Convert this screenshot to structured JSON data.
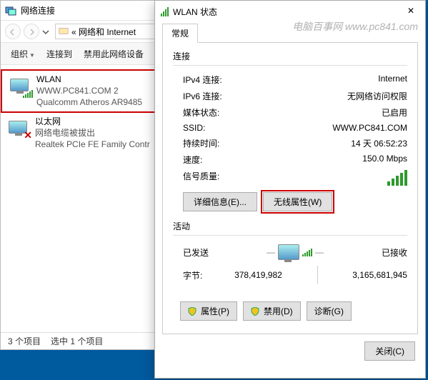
{
  "ncWindow": {
    "title": "网络连接",
    "breadcrumb": "« 网络和 Internet",
    "toolbar": {
      "organize": "组织",
      "connect": "连接到",
      "disable": "禁用此网络设备"
    },
    "adapters": [
      {
        "name": "WLAN",
        "status": "WWW.PC841.COM  2",
        "device": "Qualcomm Atheros AR9485",
        "selected": true,
        "disconnected": false
      },
      {
        "name": "以太网",
        "status": "网络电缆被拔出",
        "device": "Realtek PCIe FE Family Contr",
        "selected": false,
        "disconnected": true
      }
    ],
    "statusbar": {
      "count": "3 个项目",
      "selection": "选中 1 个项目"
    }
  },
  "statusWindow": {
    "title": "WLAN 状态",
    "watermark": "电脑百事网 www.pc841.com",
    "tab": "常规",
    "conn": {
      "header": "连接",
      "rows": {
        "ipv4_k": "IPv4 连接:",
        "ipv4_v": "Internet",
        "ipv6_k": "IPv6 连接:",
        "ipv6_v": "无网络访问权限",
        "media_k": "媒体状态:",
        "media_v": "已启用",
        "ssid_k": "SSID:",
        "ssid_v": "WWW.PC841.COM",
        "dur_k": "持续时间:",
        "dur_v": "14 天 06:52:23",
        "speed_k": "速度:",
        "speed_v": "150.0 Mbps",
        "sig_k": "信号质量:"
      },
      "details_btn": "详细信息(E)...",
      "wprops_btn": "无线属性(W)"
    },
    "activity": {
      "header": "活动",
      "sent": "已发送",
      "recv": "已接收",
      "bytes_k": "字节:",
      "bytes_sent": "378,419,982",
      "bytes_recv": "3,165,681,945"
    },
    "buttons": {
      "props": "属性(P)",
      "disable": "禁用(D)",
      "diag": "诊断(G)",
      "close": "关闭(C)"
    }
  },
  "footer_wm": "电脑百事网"
}
